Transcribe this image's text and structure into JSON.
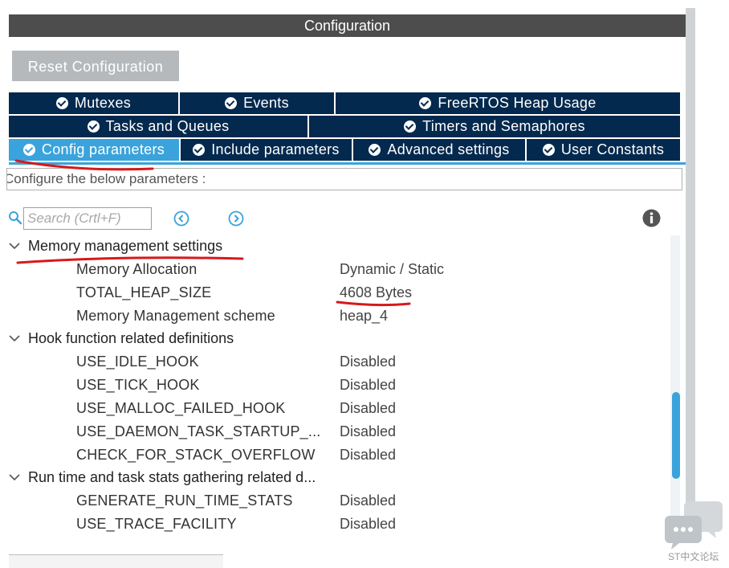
{
  "window": {
    "title": "Configuration"
  },
  "toolbar": {
    "reset_label": "Reset Configuration"
  },
  "tabs": {
    "row1": [
      {
        "label": "Mutexes"
      },
      {
        "label": "Events"
      },
      {
        "label": "FreeRTOS Heap Usage"
      }
    ],
    "row2": [
      {
        "label": "Tasks and Queues"
      },
      {
        "label": "Timers and Semaphores"
      }
    ],
    "row3": [
      {
        "label": "Config parameters",
        "active": true
      },
      {
        "label": "Include parameters"
      },
      {
        "label": "Advanced settings"
      },
      {
        "label": "User Constants"
      }
    ]
  },
  "description": "Configure the below parameters :",
  "search": {
    "placeholder": "Search (Crtl+F)",
    "value": ""
  },
  "icons": {
    "search": "search-icon",
    "prev": "previous-match-icon",
    "next": "next-match-icon",
    "info": "info-icon",
    "check": "check-circle-icon",
    "expand": "chevron-down-icon"
  },
  "groups": [
    {
      "label": "Memory management settings",
      "params": [
        {
          "name": "Memory Allocation",
          "value": "Dynamic / Static"
        },
        {
          "name": "TOTAL_HEAP_SIZE",
          "value": "4608 Bytes"
        },
        {
          "name": "Memory Management scheme",
          "value": "heap_4"
        }
      ]
    },
    {
      "label": "Hook function related definitions",
      "params": [
        {
          "name": "USE_IDLE_HOOK",
          "value": "Disabled"
        },
        {
          "name": "USE_TICK_HOOK",
          "value": "Disabled"
        },
        {
          "name": "USE_MALLOC_FAILED_HOOK",
          "value": "Disabled"
        },
        {
          "name": "USE_DAEMON_TASK_STARTUP_...",
          "value": "Disabled"
        },
        {
          "name": "CHECK_FOR_STACK_OVERFLOW",
          "value": "Disabled"
        }
      ]
    },
    {
      "label": "Run time and task stats gathering related d...",
      "params": [
        {
          "name": "GENERATE_RUN_TIME_STATS",
          "value": "Disabled"
        },
        {
          "name": "USE_TRACE_FACILITY",
          "value": "Disabled"
        }
      ]
    }
  ],
  "watermark": {
    "text": "ST中文论坛"
  },
  "colors": {
    "tab_bg": "#04294e",
    "tab_active": "#3aa3db",
    "title_bar": "#4d4d4d",
    "annotation": "#d7191c"
  }
}
